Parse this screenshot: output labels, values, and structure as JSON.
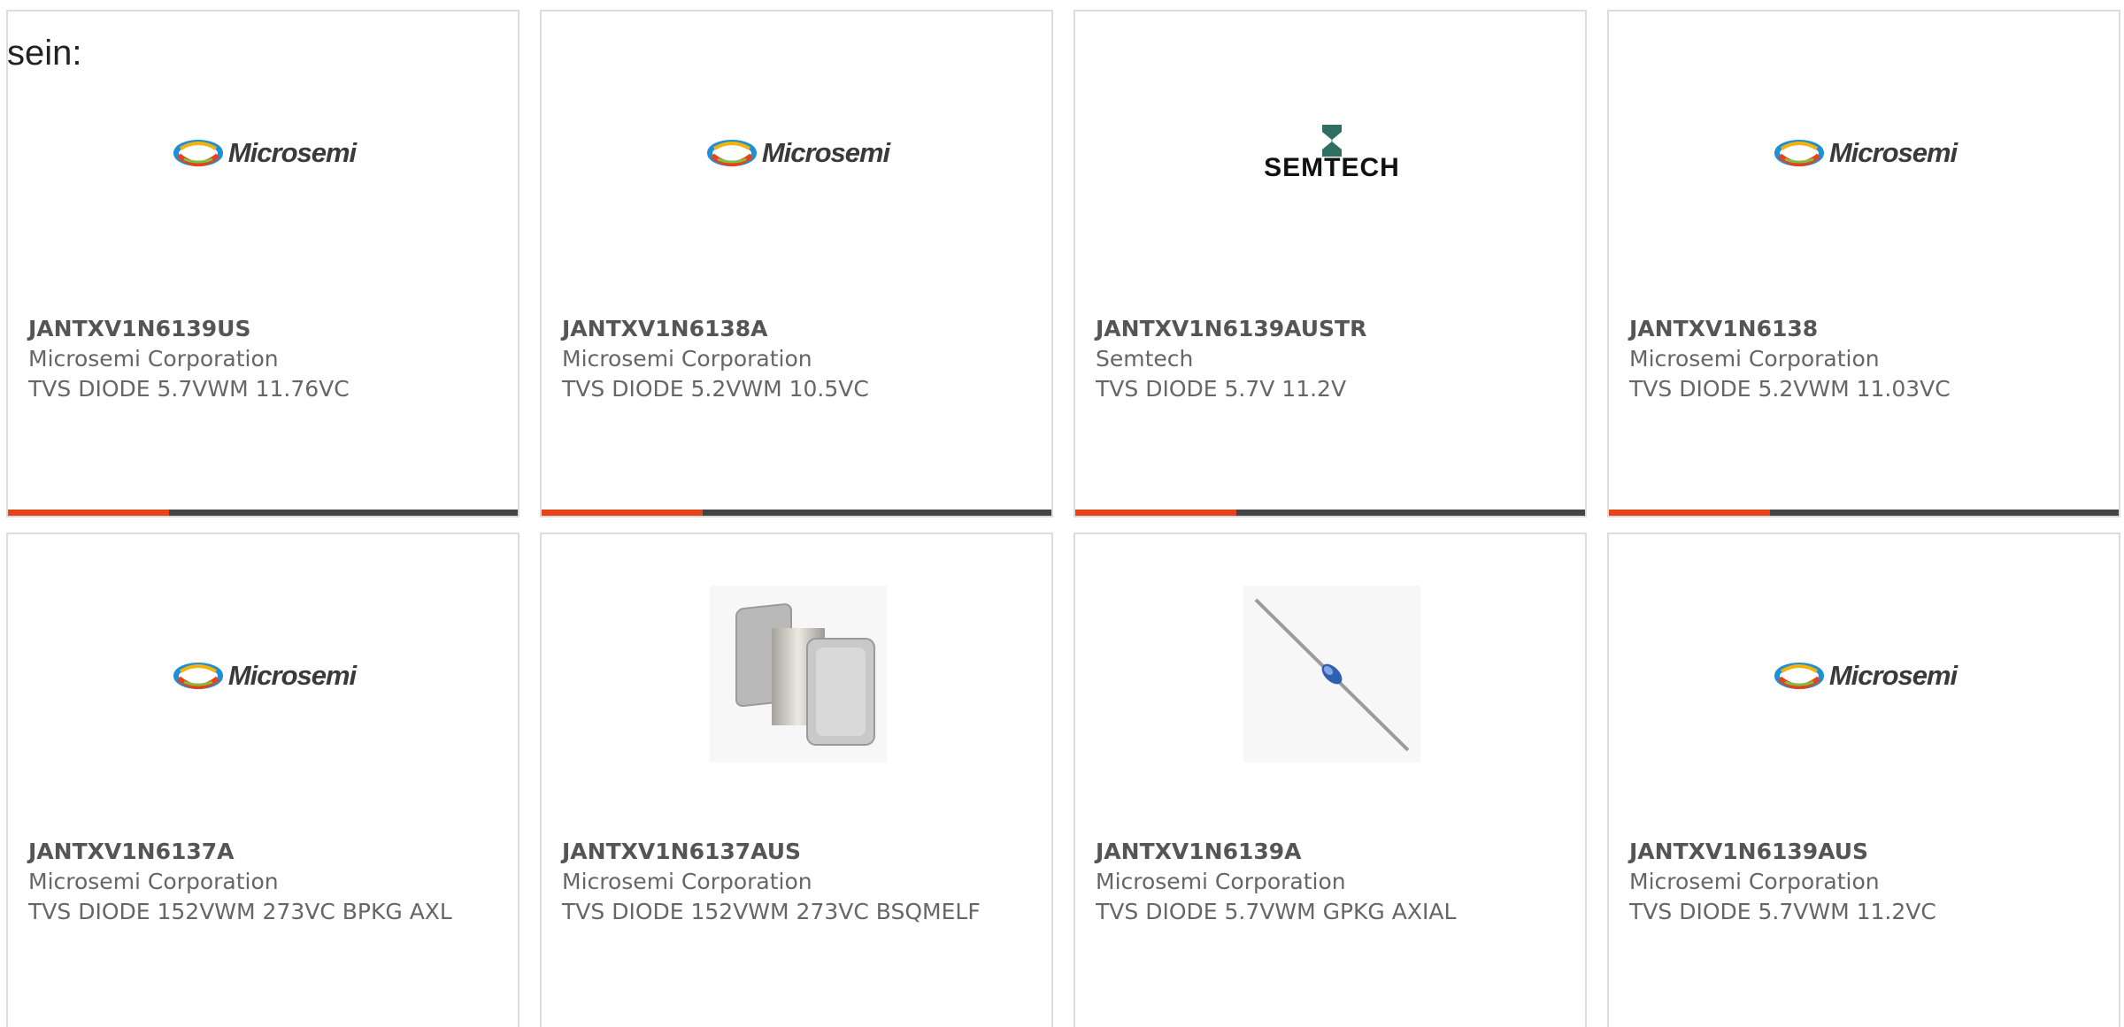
{
  "heading": "sein:",
  "colors": {
    "accent": "#e8421b",
    "bar": "#444444",
    "border": "#dcdcdc",
    "text": "#666666"
  },
  "products": [
    {
      "part_number": "JANTXV1N6139US",
      "manufacturer": "Microsemi Corporation",
      "description": "TVS DIODE 5.7VWM 11.76VC",
      "image": "microsemi-logo",
      "logo_text": "Microsemi",
      "show_bar": true
    },
    {
      "part_number": "JANTXV1N6138A",
      "manufacturer": "Microsemi Corporation",
      "description": "TVS DIODE 5.2VWM 10.5VC",
      "image": "microsemi-logo",
      "logo_text": "Microsemi",
      "show_bar": true
    },
    {
      "part_number": "JANTXV1N6139AUSTR",
      "manufacturer": "Semtech",
      "description": "TVS DIODE 5.7V 11.2V",
      "image": "semtech-logo",
      "logo_text": "SEMTECH",
      "show_bar": true
    },
    {
      "part_number": "JANTXV1N6138",
      "manufacturer": "Microsemi Corporation",
      "description": "TVS DIODE 5.2VWM 11.03VC",
      "image": "microsemi-logo",
      "logo_text": "Microsemi",
      "show_bar": true
    },
    {
      "part_number": "JANTXV1N6137A",
      "manufacturer": "Microsemi Corporation",
      "description": "TVS DIODE 152VWM 273VC BPKG AXL",
      "image": "microsemi-logo",
      "logo_text": "Microsemi",
      "show_bar": false
    },
    {
      "part_number": "JANTXV1N6137AUS",
      "manufacturer": "Microsemi Corporation",
      "description": "TVS DIODE 152VWM 273VC BSQMELF",
      "image": "smd-melf-photo",
      "logo_text": "",
      "show_bar": false
    },
    {
      "part_number": "JANTXV1N6139A",
      "manufacturer": "Microsemi Corporation",
      "description": "TVS DIODE 5.7VWM GPKG AXIAL",
      "image": "axial-diode-photo",
      "logo_text": "",
      "show_bar": false
    },
    {
      "part_number": "JANTXV1N6139AUS",
      "manufacturer": "Microsemi Corporation",
      "description": "TVS DIODE 5.7VWM 11.2VC",
      "image": "microsemi-logo",
      "logo_text": "Microsemi",
      "show_bar": false
    }
  ]
}
